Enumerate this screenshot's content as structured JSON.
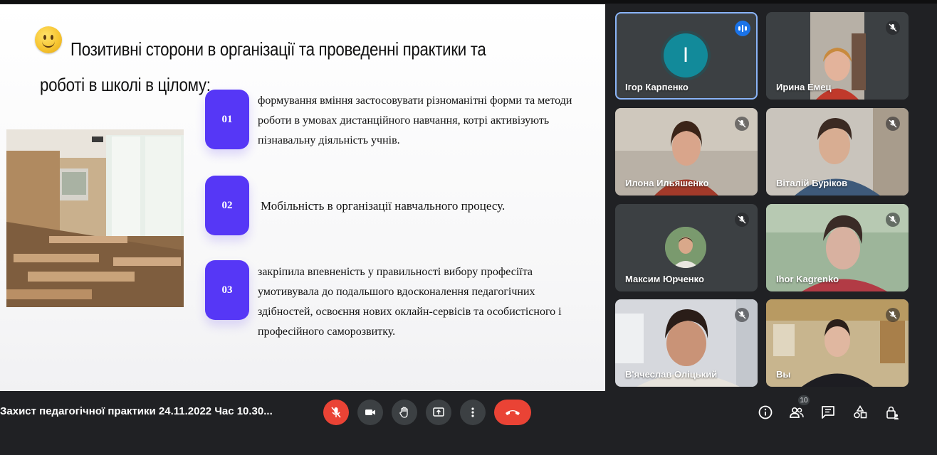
{
  "slide": {
    "title_line1": "Позитивні сторони в організації та проведенні практики та",
    "title_line2": "роботі в школі в цілому:",
    "points": [
      {
        "number": "01",
        "text": "формування вміння застосовувати різноманітні форми та методи роботи в умовах дистанційного навчання, котрі активізують пізнавальну діяльність учнів."
      },
      {
        "number": "02",
        "text": "Мобільність в організації навчального процесу."
      },
      {
        "number": "03",
        "text": "закріпила впевненість у правильності вибору професіїта умотивувала до подальшого вдосконалення педагогічних здібностей, освоєння нових оклайн-сервісів та особистісного і професійного саморозвитку."
      }
    ]
  },
  "participants": [
    {
      "name": "Ігор Карпенко",
      "avatar_letter": "I",
      "speaking": true
    },
    {
      "name": "Ирина Емец",
      "muted": true
    },
    {
      "name": "Илона Ильяшенко",
      "muted": true
    },
    {
      "name": "Віталій Буріков",
      "muted": true
    },
    {
      "name": "Максим Юрченко",
      "muted": true
    },
    {
      "name": "Ihor Kagrenko",
      "muted": true
    },
    {
      "name": "В'ячеслав Оліцький",
      "muted": true
    },
    {
      "name": "Вы",
      "muted": true
    }
  ],
  "meeting": {
    "title": "Захист педагогічної практики 24.11.2022 Час 10.30...",
    "participant_count": "10"
  },
  "colors": {
    "accent": "#5637f6",
    "danger": "#ea4335",
    "bg": "#202124",
    "tile": "#3c4043",
    "speaking": "#1a73e8"
  }
}
